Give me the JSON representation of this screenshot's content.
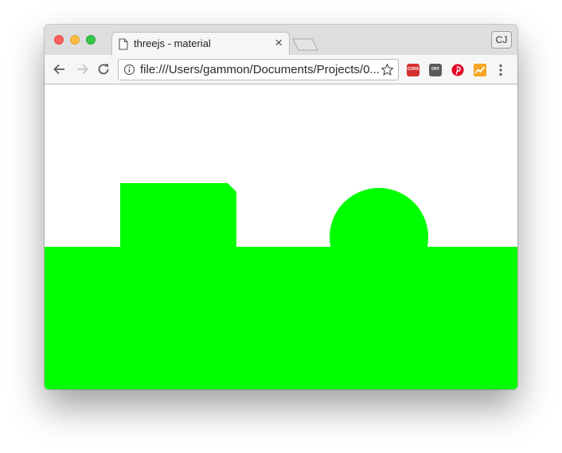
{
  "browser": {
    "tab": {
      "title": "threejs - material",
      "close_glyph": "×",
      "icon": "page-icon"
    },
    "profile": {
      "initials": "CJ"
    },
    "address_bar": {
      "url": "file:///Users/gammon/Documents/Projects/0..."
    },
    "extensions": [
      {
        "name": "cors-extension",
        "label": "CORS"
      },
      {
        "name": "off-extension",
        "label": "OFF"
      },
      {
        "name": "pinterest-extension"
      },
      {
        "name": "chart-extension"
      }
    ]
  },
  "scene": {
    "background_color": "#ffffff",
    "mesh_color": "#00ff00",
    "objects": [
      "ground-plane",
      "cube",
      "sphere"
    ]
  },
  "colors": {
    "titlebar": "#dedede",
    "toolbar": "#f6f6f6",
    "close": "#fc605c",
    "minimize": "#fdbc40",
    "maximize": "#34c84a"
  }
}
